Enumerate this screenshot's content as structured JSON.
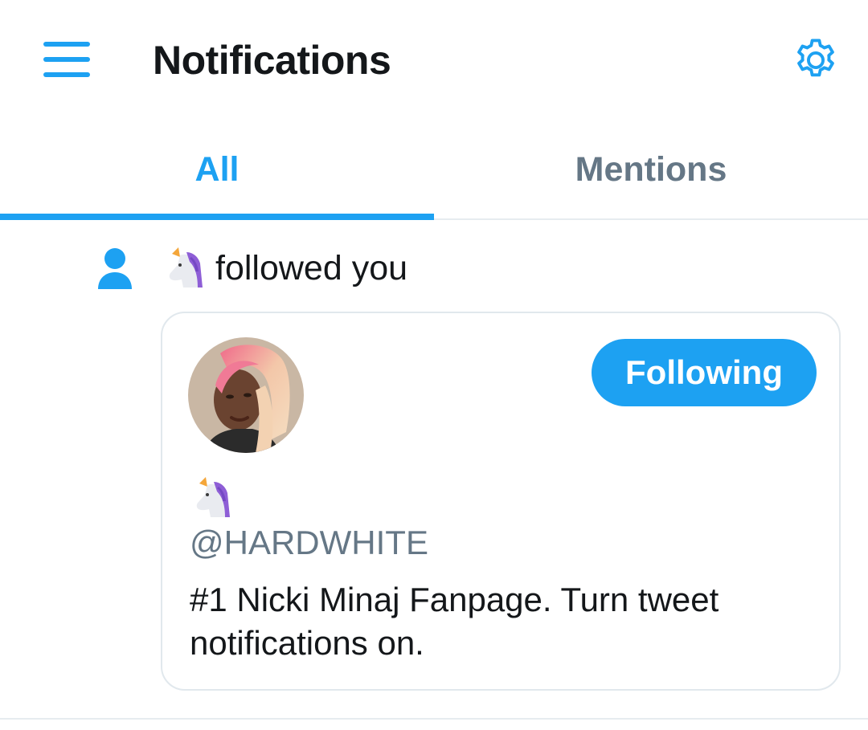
{
  "header": {
    "title": "Notifications",
    "menu_icon": "hamburger-menu-icon",
    "settings_icon": "gear-icon"
  },
  "tabs": [
    {
      "label": "All",
      "active": true
    },
    {
      "label": "Mentions",
      "active": false
    }
  ],
  "notification": {
    "type_icon": "person-icon",
    "actor_emoji": "unicorn",
    "text": "followed you",
    "profile": {
      "avatar": "profile-photo",
      "follow_button_label": "Following",
      "name_emoji": "unicorn",
      "handle": "@HARDWHITE",
      "bio": "#1 Nicki Minaj Fanpage. Turn tweet notifications on."
    }
  },
  "colors": {
    "accent": "#1da1f2",
    "text_primary": "#14171a",
    "text_secondary": "#657786",
    "border": "#e1e8ed"
  }
}
